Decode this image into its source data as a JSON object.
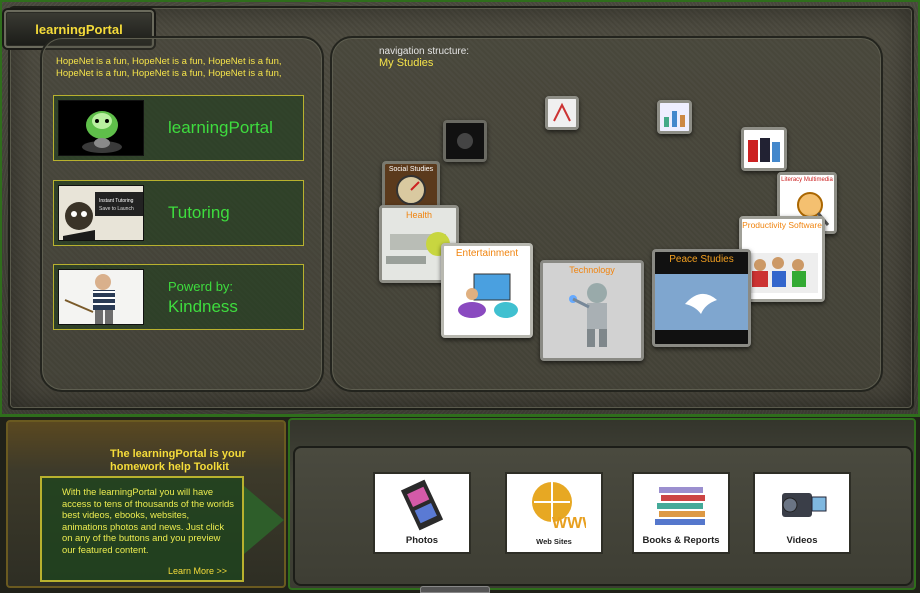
{
  "app": {
    "title": "learningPortal"
  },
  "ticker": {
    "text": "HopeNet is a fun, HopeNet is a fun, HopeNet is a fun, HopeNet is a fun, HopeNet is a fun, HopeNet is a fun,"
  },
  "cards": [
    {
      "label": "learningPortal",
      "sub": ""
    },
    {
      "label": "Tutoring",
      "sub": ""
    },
    {
      "label": "Kindness",
      "sub": "Powerd by:"
    }
  ],
  "navigation": {
    "caption": "navigation structure:",
    "path": "My Studies"
  },
  "tiles": {
    "social": "Social Studies",
    "health": "Health",
    "entertainment": "Entertainment",
    "technology": "Technology",
    "peace": "Peace Studies",
    "productivity": "Productivity Software",
    "literacy": "Literacy Multimedia"
  },
  "promo": {
    "title": "The learningPortal is your homework help Toolkit",
    "body": "With the learningPortal you will have access to tens of thousands of the worlds best videos, ebooks, websites, animations photos and news. Just click on any of the buttons and you preview our featured content.",
    "more": "Learn More >>"
  },
  "media": [
    {
      "label": "Photos",
      "icon": "film-strip-icon"
    },
    {
      "label": "Web Sites",
      "icon": "globe-www-icon"
    },
    {
      "label": "Books & Reports",
      "icon": "books-icon"
    },
    {
      "label": "Videos",
      "icon": "camcorder-icon"
    }
  ],
  "colors": {
    "accent": "#f5dc3a",
    "green": "#3edc3e",
    "frame": "#2f6e1c"
  }
}
